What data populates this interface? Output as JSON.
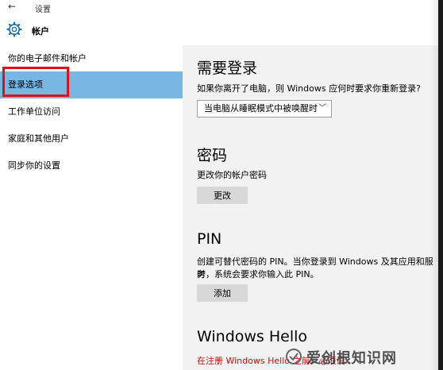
{
  "titlebar": {
    "back_icon": "back-arrow-icon",
    "title": "设置"
  },
  "header": {
    "icon": "gear-icon",
    "title": "帐户"
  },
  "sidebar": {
    "items": [
      {
        "label": "你的电子邮件和帐户"
      },
      {
        "label": "登录选项",
        "active": true
      },
      {
        "label": "工作单位访问"
      },
      {
        "label": "家庭和其他用户"
      },
      {
        "label": "同步你的设置"
      }
    ]
  },
  "main": {
    "signin": {
      "heading": "需要登录",
      "text": "如果你离开了电脑，则 Windows 应何时要求你重新登录?",
      "dropdown_value": "当电脑从睡眠模式中被唤醒时"
    },
    "password": {
      "heading": "密码",
      "text": "更改你的帐户密码",
      "button": "更改"
    },
    "pin": {
      "heading": "PIN",
      "text_line1": "创建可替代密码的 PIN。当你登录到 Windows 及其应用和服务",
      "text_line2": "时，系统会要求你输入此 PIN。",
      "button": "添加"
    },
    "hello": {
      "heading": "Windows Hello",
      "warning": "在注册 Windows Hello 之前，必须设..."
    }
  },
  "watermark": {
    "text": "爱创根知识网"
  },
  "colors": {
    "active_nav": "#78b6e4",
    "highlight_border": "#e0101a",
    "content_bg": "#f2f2f2",
    "warning": "#d01010"
  }
}
